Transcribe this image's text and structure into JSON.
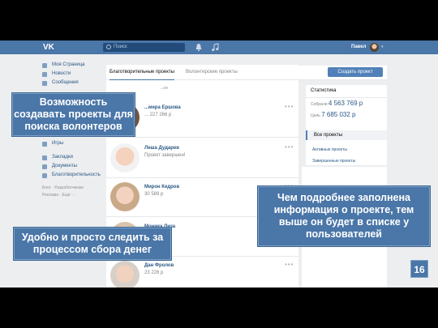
{
  "header": {
    "search_placeholder": "Поиск",
    "user_name": "Павел",
    "user_caret": "▾"
  },
  "sidebar": {
    "items": [
      {
        "label": "Моя Страница"
      },
      {
        "label": "Новости"
      },
      {
        "label": "Сообщения"
      },
      {
        "label": "Игры"
      },
      {
        "label": "Закладки"
      },
      {
        "label": "Документы"
      },
      {
        "label": "Благотворительность"
      }
    ],
    "footer_1": "Блог · Разработчикам",
    "footer_2": "Реклама · Ещё ···"
  },
  "main": {
    "tabs": [
      {
        "label": "Благотворительные проекты",
        "active": true
      },
      {
        "label": "Волонтерские проекты",
        "active": false
      }
    ],
    "create_button": "Создать проект",
    "filter_text": "...ои",
    "rows": [
      {
        "name": "...мера Ершова",
        "sum": "... 227 266 р"
      },
      {
        "name": "Леша Дударев",
        "sum": "Проект завершен!"
      },
      {
        "name": "Мирон Кедров",
        "sum": "30 589 р"
      },
      {
        "name": "Моника Лиза",
        "sum": ""
      },
      {
        "name": "Дан Фролов",
        "sum": "23 226 р"
      }
    ],
    "row_more": "•••"
  },
  "stats": {
    "title": "Статистика",
    "collected_label": "Собрали",
    "collected_value": "4 563 769 р",
    "goal_label": "Цель",
    "goal_value": "7 685 032 р"
  },
  "projects_menu": {
    "head": "Все проекты",
    "items": [
      "Активные проекты",
      "Завершенные проекты"
    ]
  },
  "overlays": {
    "callout_1": "Возможность создавать проекты для поиска волонтеров",
    "callout_2": "Удобно и просто следить за процессом сбора денег",
    "callout_3": "Чем подробнее заполнена информация о проекте, тем выше он будет в списке у пользователей",
    "slide_number": "16"
  },
  "colors": {
    "brand": "#4a76a8",
    "link": "#2a5885",
    "page_bg": "#edeef0"
  }
}
